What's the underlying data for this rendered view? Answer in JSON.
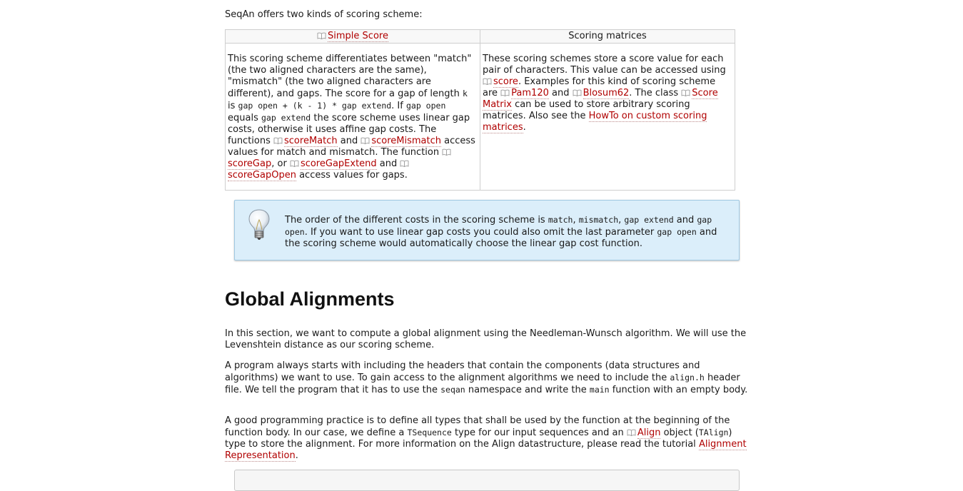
{
  "intro": "SeqAn offers two kinds of scoring scheme:",
  "table": {
    "col1_header": "Simple Score",
    "col2_header": "Scoring matrices",
    "col1": {
      "t1": "This scoring scheme differentiates between \"match\" (the two aligned characters are the same), \"mismatch\" (the two aligned characters are different), and gaps. The score for a gap of length ",
      "c1": "k",
      "t2": " is ",
      "c2": "gap open + (k - 1) * gap extend",
      "t3": ". If ",
      "c3": "gap open",
      "t4": " equals ",
      "c4": "gap extend",
      "t5": " the score scheme uses linear gap costs, otherwise it uses affine gap costs. The functions ",
      "l1": "scoreMatch",
      "t6": " and ",
      "l2": "scoreMismatch",
      "t7": " access values for match and mismatch. The function ",
      "l3": "scoreGap",
      "t8": ", or ",
      "l4": "scoreGapExtend",
      "t9": " and ",
      "l5": "scoreGapOpen",
      "t10": " access values for gaps."
    },
    "col2": {
      "t1": "These scoring schemes store a score value for each pair of characters. This value can be accessed using ",
      "l1": "score",
      "t2": ". Examples for this kind of scoring scheme are ",
      "l2": "Pam120",
      "t3": " and ",
      "l3": "Blosum62",
      "t4": ". The class ",
      "l4": "Score Matrix",
      "t5": " can be used to store arbitrary scoring matrices. Also see the ",
      "l5": "HowTo on custom scoring matrices",
      "t6": "."
    }
  },
  "tip": {
    "t1": "The order of the different costs in the scoring scheme is ",
    "c1": "match",
    "t2": ", ",
    "c2": "mismatch",
    "t3": ", ",
    "c3": "gap extend",
    "t4": " and ",
    "c4": "gap open",
    "t5": ". If you want to use linear gap costs you could also omit the last parameter ",
    "c5": "gap open",
    "t6": " and the scoring scheme would automatically choose the linear gap cost function."
  },
  "heading": "Global Alignments",
  "p1": "In this section, we want to compute a global alignment using the Needleman-Wunsch algorithm. We will use the Levenshtein distance as our scoring scheme.",
  "p2": {
    "t1": "A program always starts with including the headers that contain the components (data structures and algorithms) we want to use. To gain access to the alignment algorithms we need to include the ",
    "c1": "align.h",
    "t2": " header file. We tell the program that it has to use the ",
    "c2": "seqan",
    "t3": " namespace and write the ",
    "c3": "main",
    "t4": " function with an empty body."
  },
  "p3": {
    "t1": "A good programming practice is to define all types that shall be used by the function at the beginning of the function body. In our case, we define a ",
    "c1": "TSequence",
    "t2": " type for our input sequences and an ",
    "l1": "Align",
    "t3": " object (",
    "c2": "TAlign",
    "t4": ") type to store the alignment. For more information on the Align datastructure, please read the tutorial ",
    "l2": "Alignment Representation",
    "t5": "."
  },
  "colors": {
    "link": "#b00000",
    "tip_bg": "#dbeefa",
    "tip_border": "#9fc8e2"
  }
}
